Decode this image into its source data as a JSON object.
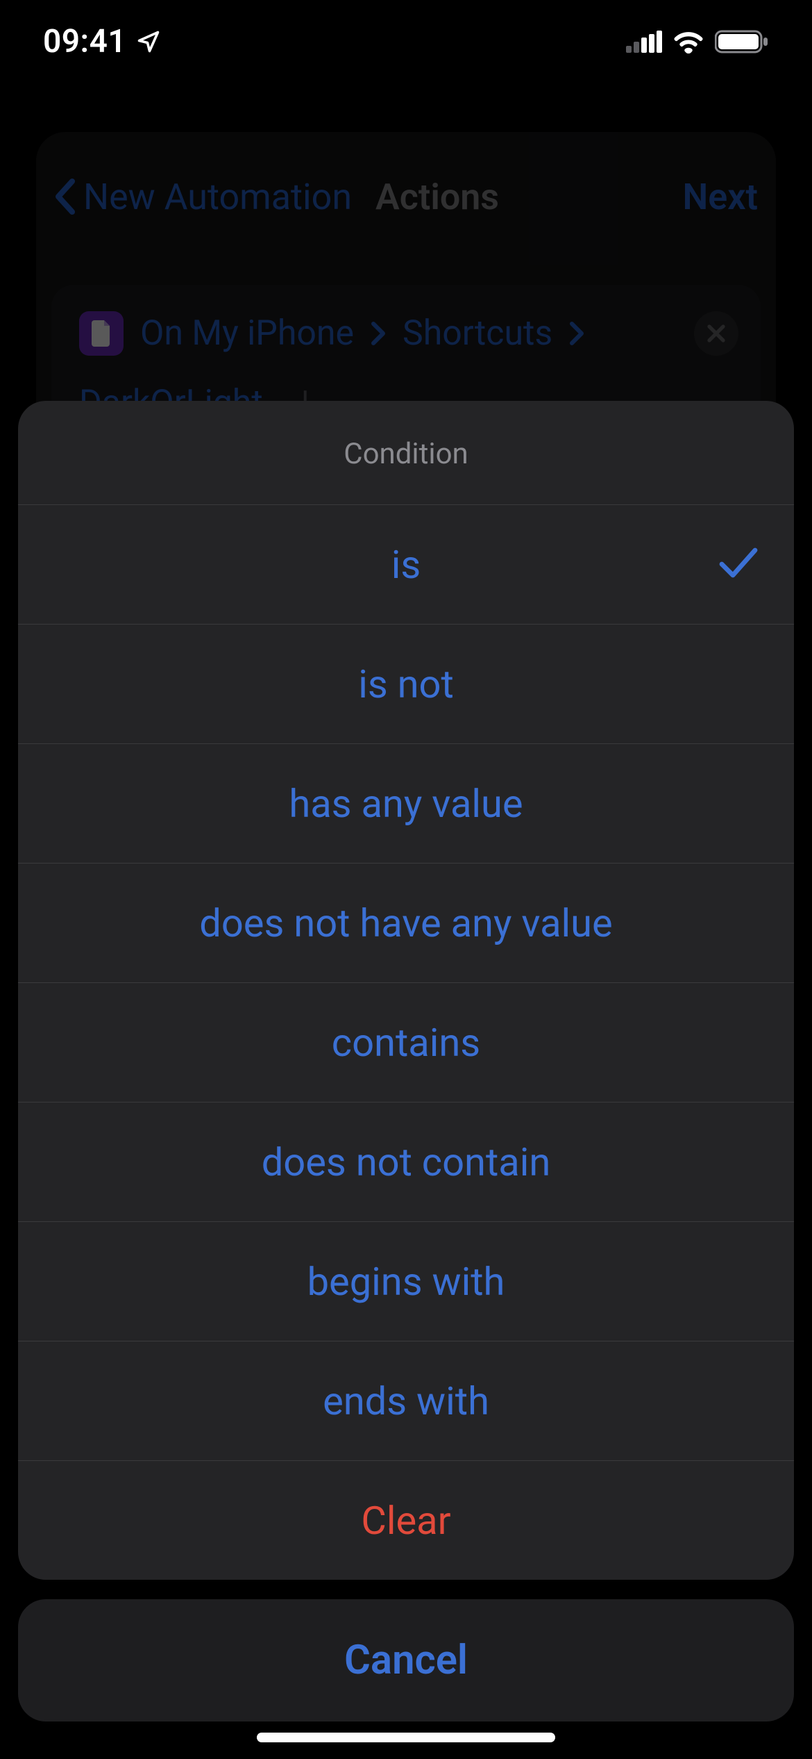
{
  "status_bar": {
    "time": "09:41"
  },
  "background_page": {
    "back_label": "New Automation",
    "title": "Actions",
    "next_label": "Next",
    "action_card": {
      "breadcrumb1": "On My iPhone",
      "breadcrumb2": "Shortcuts",
      "variable_name": "DarkOrLight"
    }
  },
  "condition_sheet": {
    "title": "Condition",
    "selected_index": 0,
    "options": [
      "is",
      "is not",
      "has any value",
      "does not have any value",
      "contains",
      "does not contain",
      "begins with",
      "ends with"
    ],
    "clear_label": "Clear",
    "cancel_label": "Cancel"
  },
  "colors": {
    "accent": "#3b70d4",
    "destructive": "#e24a3b"
  }
}
